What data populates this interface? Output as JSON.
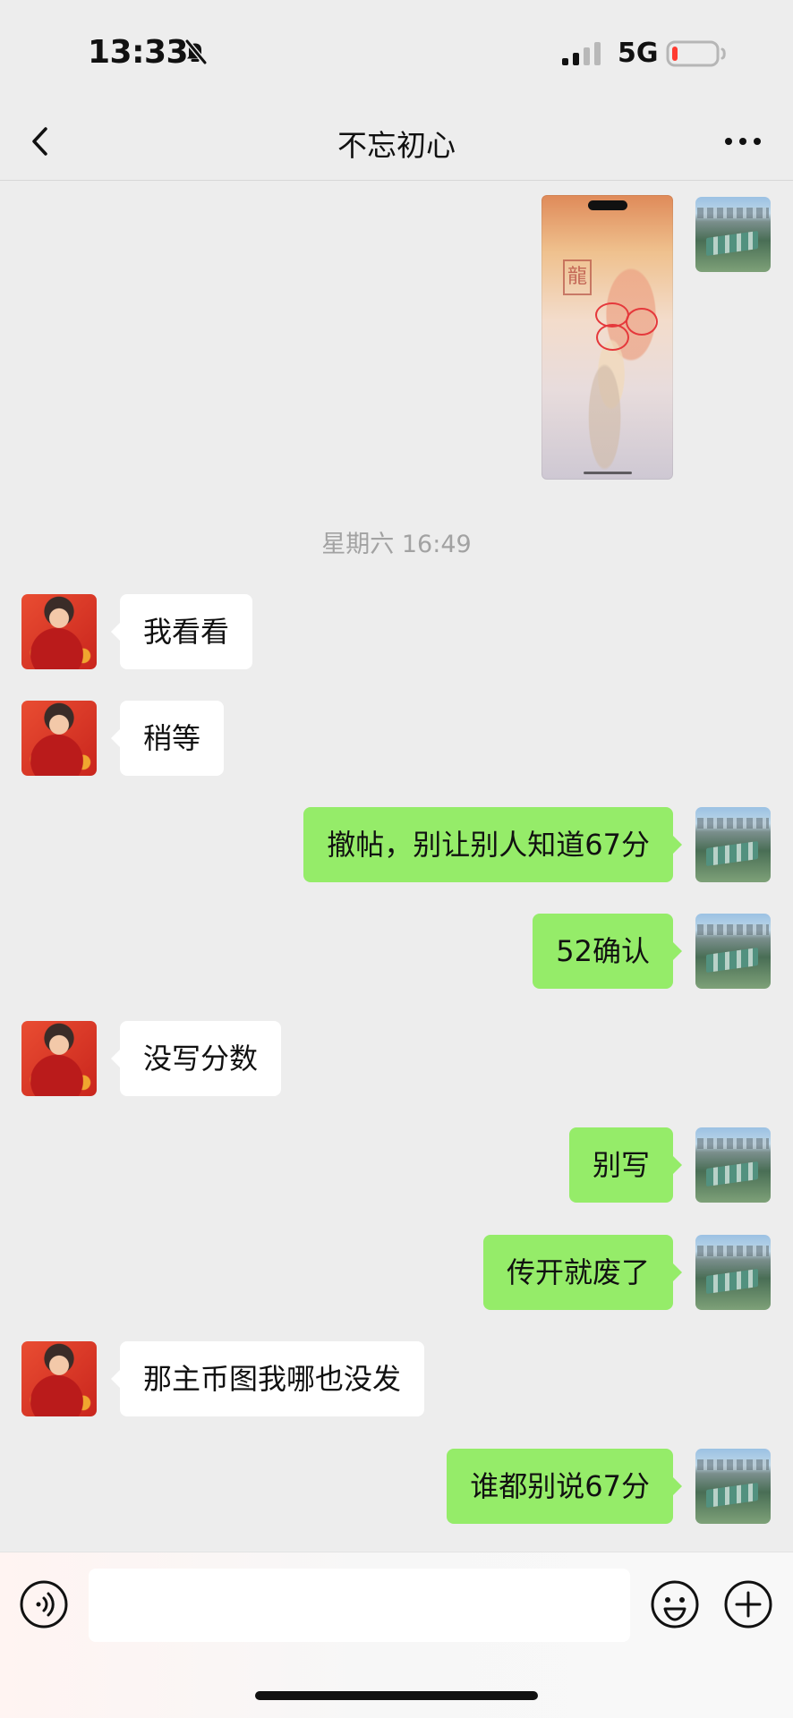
{
  "status_bar": {
    "time": "13:33",
    "network": "5G",
    "battery_state": "low",
    "icons": [
      "bell-slash-icon",
      "signal-icon",
      "battery-icon"
    ]
  },
  "header": {
    "title": "不忘初心",
    "icons": {
      "back": "chevron-left-icon",
      "more": "more-icon"
    }
  },
  "conversation": {
    "timestamp": "星期六 16:49",
    "messages": [
      {
        "sender": "other",
        "text": "我看看"
      },
      {
        "sender": "other",
        "text": "稍等"
      },
      {
        "sender": "self",
        "text": "撤帖，别让别人知道67分"
      },
      {
        "sender": "self",
        "text": "52确认"
      },
      {
        "sender": "other",
        "text": "没写分数"
      },
      {
        "sender": "self",
        "text": "别写"
      },
      {
        "sender": "self",
        "text": "传开就废了"
      },
      {
        "sender": "other",
        "text": "那主币图我哪也没发"
      },
      {
        "sender": "self",
        "text": "谁都别说67分"
      }
    ],
    "image_message": {
      "sender": "self",
      "description_icon": "image-thumbnail"
    }
  },
  "composer": {
    "value": "",
    "placeholder": "",
    "icons": {
      "voice": "voice-icon",
      "emoji": "smile-icon",
      "plus": "plus-circle-icon"
    }
  },
  "colors": {
    "background": "#ededed",
    "self_bubble": "#95ec69",
    "other_bubble": "#ffffff",
    "timestamp": "#a2a2a2"
  }
}
